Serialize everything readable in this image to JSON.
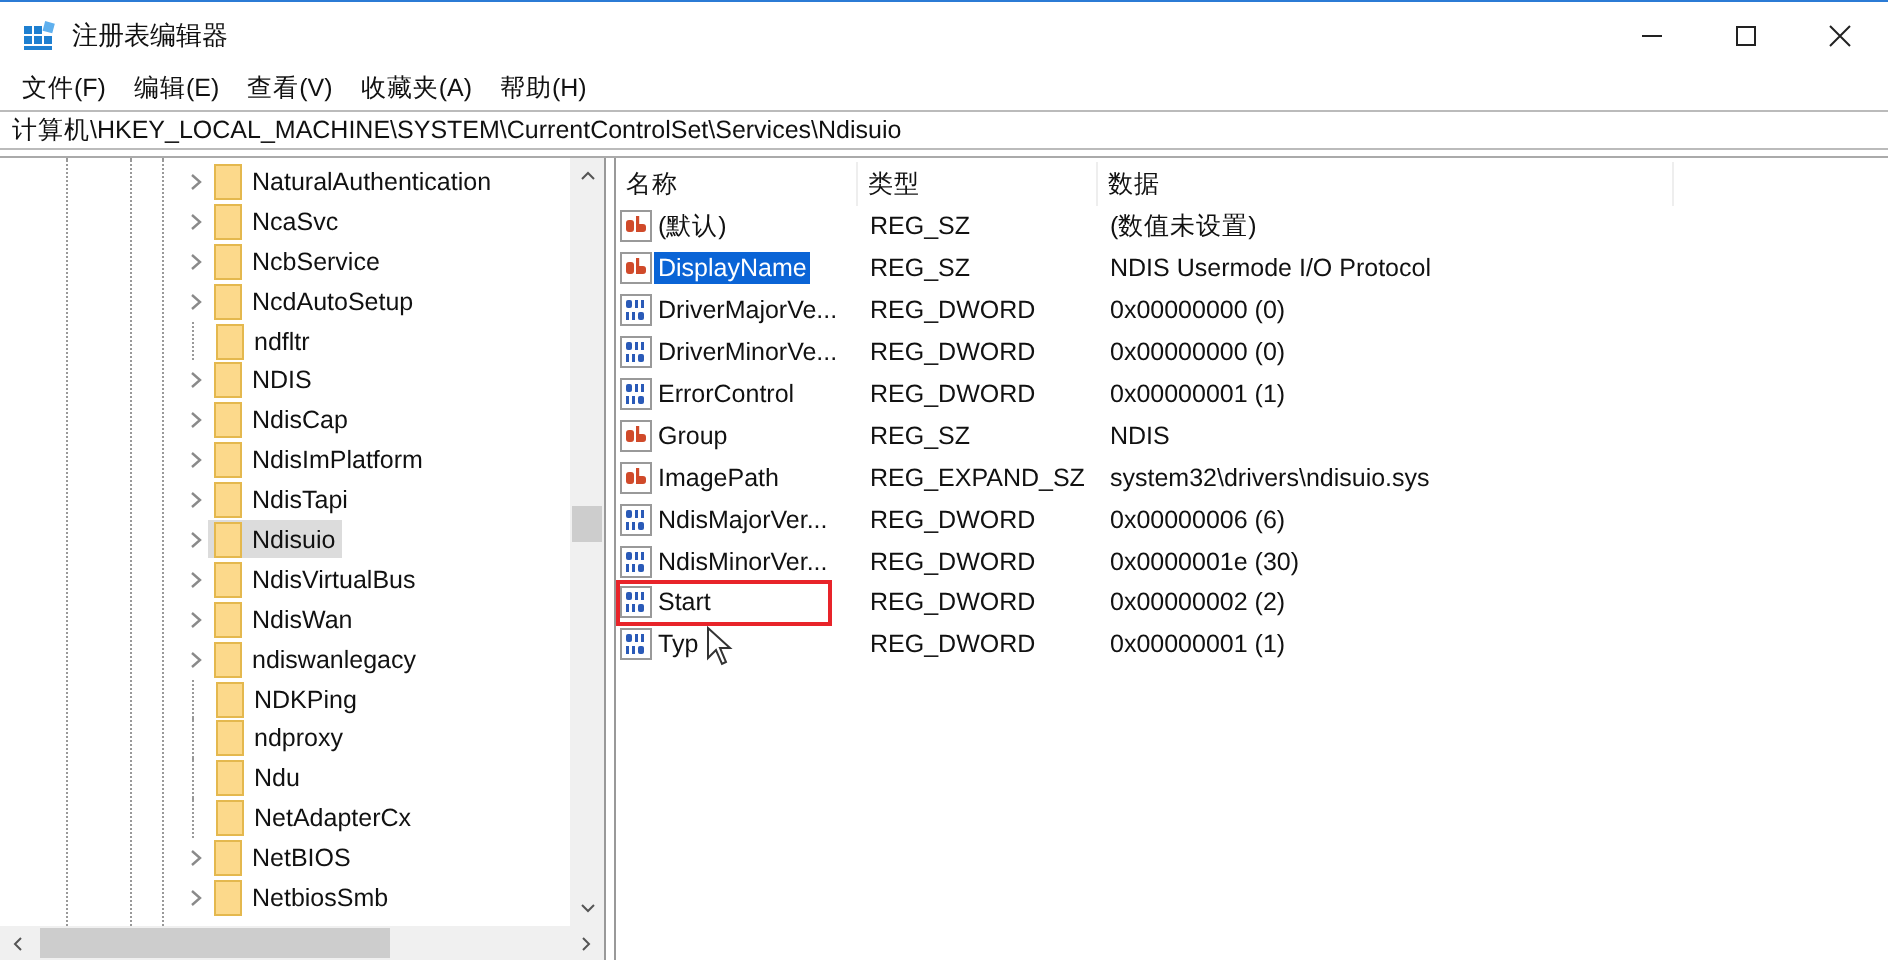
{
  "window": {
    "title": "注册表编辑器"
  },
  "menu": [
    "文件(F)",
    "编辑(E)",
    "查看(V)",
    "收藏夹(A)",
    "帮助(H)"
  ],
  "address": "计算机\\HKEY_LOCAL_MACHINE\\SYSTEM\\CurrentControlSet\\Services\\Ndisuio",
  "tree": [
    {
      "label": "NaturalAuthentication",
      "kind": "expandable",
      "selected": false
    },
    {
      "label": "NcaSvc",
      "kind": "expandable",
      "selected": false
    },
    {
      "label": "NcbService",
      "kind": "expandable",
      "selected": false
    },
    {
      "label": "NcdAutoSetup",
      "kind": "expandable",
      "selected": false
    },
    {
      "label": "ndfltr",
      "kind": "leaf",
      "selected": false
    },
    {
      "label": "NDIS",
      "kind": "expandable",
      "selected": false
    },
    {
      "label": "NdisCap",
      "kind": "expandable",
      "selected": false
    },
    {
      "label": "NdisImPlatform",
      "kind": "expandable",
      "selected": false
    },
    {
      "label": "NdisTapi",
      "kind": "expandable",
      "selected": false
    },
    {
      "label": "Ndisuio",
      "kind": "expandable",
      "selected": true
    },
    {
      "label": "NdisVirtualBus",
      "kind": "expandable",
      "selected": false
    },
    {
      "label": "NdisWan",
      "kind": "expandable",
      "selected": false
    },
    {
      "label": "ndiswanlegacy",
      "kind": "expandable",
      "selected": false
    },
    {
      "label": "NDKPing",
      "kind": "leaf",
      "selected": false
    },
    {
      "label": "ndproxy",
      "kind": "leaf",
      "selected": false
    },
    {
      "label": "Ndu",
      "kind": "leaf",
      "selected": false
    },
    {
      "label": "NetAdapterCx",
      "kind": "leaf",
      "selected": false
    },
    {
      "label": "NetBIOS",
      "kind": "expandable",
      "selected": false
    },
    {
      "label": "NetbiosSmb",
      "kind": "expandable",
      "selected": false
    }
  ],
  "values": {
    "columns": [
      "名称",
      "类型",
      "数据"
    ],
    "rows": [
      {
        "name": "(默认)",
        "type": "REG_SZ",
        "data": "(数值未设置)",
        "kind": "string",
        "selected": false,
        "outlined": false
      },
      {
        "name": "DisplayName",
        "type": "REG_SZ",
        "data": "NDIS Usermode I/O Protocol",
        "kind": "string",
        "selected": true,
        "outlined": false
      },
      {
        "name": "DriverMajorVe...",
        "type": "REG_DWORD",
        "data": "0x00000000 (0)",
        "kind": "binary",
        "selected": false,
        "outlined": false
      },
      {
        "name": "DriverMinorVe...",
        "type": "REG_DWORD",
        "data": "0x00000000 (0)",
        "kind": "binary",
        "selected": false,
        "outlined": false
      },
      {
        "name": "ErrorControl",
        "type": "REG_DWORD",
        "data": "0x00000001 (1)",
        "kind": "binary",
        "selected": false,
        "outlined": false
      },
      {
        "name": "Group",
        "type": "REG_SZ",
        "data": "NDIS",
        "kind": "string",
        "selected": false,
        "outlined": false
      },
      {
        "name": "ImagePath",
        "type": "REG_EXPAND_SZ",
        "data": "system32\\drivers\\ndisuio.sys",
        "kind": "string",
        "selected": false,
        "outlined": false
      },
      {
        "name": "NdisMajorVer...",
        "type": "REG_DWORD",
        "data": "0x00000006 (6)",
        "kind": "binary",
        "selected": false,
        "outlined": false
      },
      {
        "name": "NdisMinorVer...",
        "type": "REG_DWORD",
        "data": "0x0000001e (30)",
        "kind": "binary",
        "selected": false,
        "outlined": false
      },
      {
        "name": "Start",
        "type": "REG_DWORD",
        "data": "0x00000002 (2)",
        "kind": "binary",
        "selected": false,
        "outlined": true
      },
      {
        "name": "Typ",
        "type": "REG_DWORD",
        "data": "0x00000001 (1)",
        "kind": "binary",
        "selected": false,
        "outlined": false
      }
    ]
  }
}
